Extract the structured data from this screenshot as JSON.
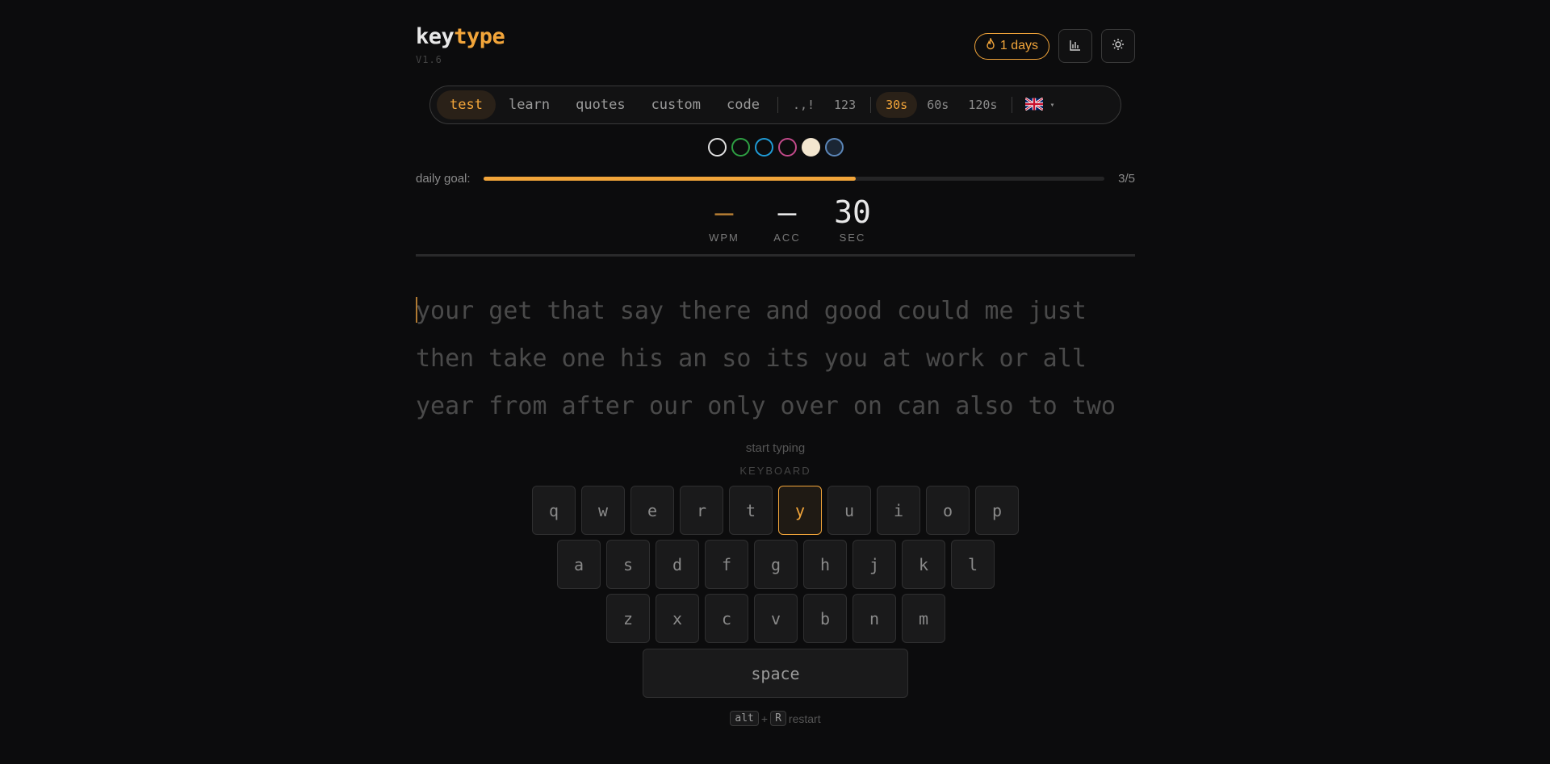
{
  "app": {
    "name_part1": "key",
    "name_part2": "type",
    "version": "V1.6"
  },
  "header": {
    "streak_label": "1 days",
    "stats_icon": "bar-chart-icon",
    "theme_icon": "sun-icon",
    "streak_icon": "flame-icon"
  },
  "modes": [
    "test",
    "learn",
    "quotes",
    "custom",
    "code"
  ],
  "active_mode": "test",
  "options": {
    "punctuation": ".,!",
    "numbers": "123"
  },
  "durations": [
    "30s",
    "60s",
    "120s"
  ],
  "active_duration": "30s",
  "language": {
    "flag": "uk-flag-icon",
    "caret": "▾"
  },
  "themes": [
    {
      "name": "dark",
      "color": "#0c0c0d",
      "border": "#e0e0e0"
    },
    {
      "name": "green",
      "color": "#0c0c0d",
      "border": "#2ea043"
    },
    {
      "name": "blue",
      "color": "#0c0c0d",
      "border": "#1f9bd6"
    },
    {
      "name": "pink",
      "color": "#0c0c0d",
      "border": "#c24a8a"
    },
    {
      "name": "cream",
      "color": "#f3e6cf",
      "border": "#f3e6cf"
    },
    {
      "name": "slate",
      "color": "#1b2634",
      "border": "#5b86b8"
    }
  ],
  "goal": {
    "label": "daily goal:",
    "count": "3/5",
    "progress": 0.6
  },
  "stats": [
    {
      "value": "—",
      "label": "WPM",
      "color": "#b07a32"
    },
    {
      "value": "—",
      "label": "ACC",
      "color": "#e8e8e8"
    },
    {
      "value": "30",
      "label": "SEC",
      "color": "#e8e8e8"
    }
  ],
  "words": [
    "your get that say there and good could me just",
    "then take one his an so its you at work or all",
    "year from after our only over on can also to two"
  ],
  "hint": "start typing",
  "keyboard": {
    "title": "KEYBOARD",
    "rows": [
      [
        "q",
        "w",
        "e",
        "r",
        "t",
        "y",
        "u",
        "i",
        "o",
        "p"
      ],
      [
        "a",
        "s",
        "d",
        "f",
        "g",
        "h",
        "j",
        "k",
        "l"
      ],
      [
        "z",
        "x",
        "c",
        "v",
        "b",
        "n",
        "m"
      ]
    ],
    "highlight": "y",
    "space": "space"
  },
  "restart": {
    "key1": "alt",
    "plus": "+",
    "key2": "R",
    "label": "restart"
  },
  "colors": {
    "accent": "#f2a53a",
    "background": "#0c0c0d"
  }
}
